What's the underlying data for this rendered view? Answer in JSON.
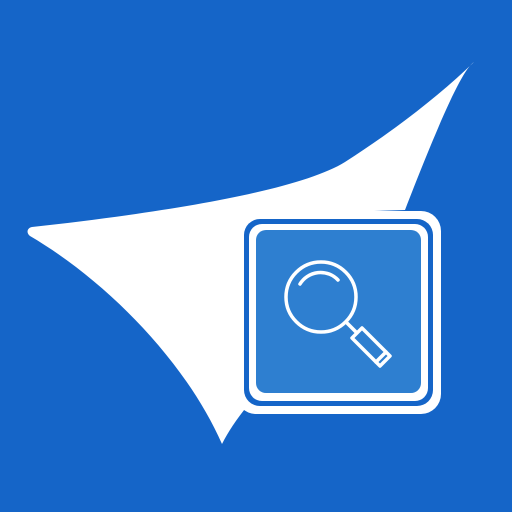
{
  "icon": {
    "background_icon": "app-tile",
    "main_glyph": "sail-arrow-icon",
    "badge_glyph": "magnifying-glass-icon",
    "colors": {
      "background": "#1565c8",
      "glyph": "#ffffff",
      "badge_fill": "#2e7fd0"
    }
  }
}
